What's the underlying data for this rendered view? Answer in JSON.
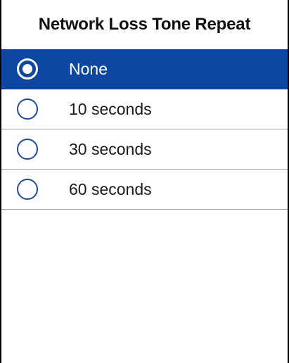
{
  "dialog": {
    "title": "Network Loss Tone Repeat"
  },
  "options": [
    {
      "label": "None",
      "selected": true
    },
    {
      "label": "10 seconds",
      "selected": false
    },
    {
      "label": "30 seconds",
      "selected": false
    },
    {
      "label": "60 seconds",
      "selected": false
    }
  ],
  "colors": {
    "accent": "#0d47a1",
    "radio_border": "#1e4aa5",
    "divider": "#9e9e9e"
  }
}
